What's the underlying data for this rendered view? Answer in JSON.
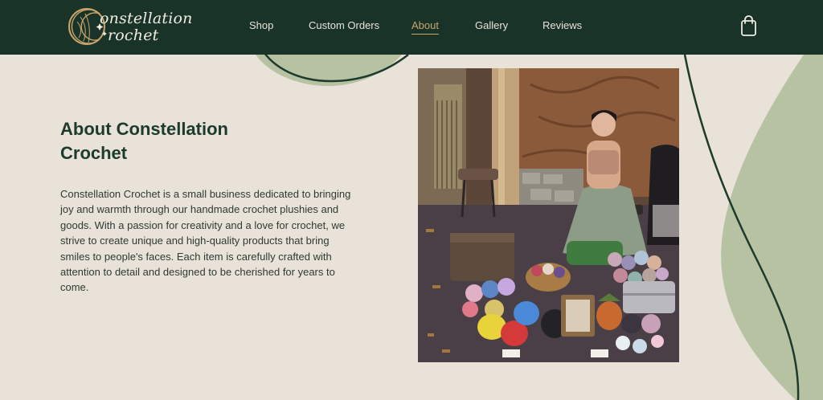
{
  "brand": {
    "line1": "onstellation",
    "line2": "rochet"
  },
  "nav": {
    "items": [
      {
        "label": "Shop"
      },
      {
        "label": "Custom Orders"
      },
      {
        "label": "About",
        "active": true
      },
      {
        "label": "Gallery"
      },
      {
        "label": "Reviews"
      }
    ],
    "cart_icon": "shopping-bag-icon"
  },
  "about": {
    "title": "About Constellation Crochet",
    "body": "Constellation Crochet is a small business dedicated to bringing joy and warmth through our handmade crochet plushies and goods. With a passion for creativity and a love for crochet, we strive to create unique and high-quality products that bring smiles to people's faces. Each item is carefully crafted with attention to detail and designed to be cherished for years to come."
  },
  "colors": {
    "nav_bg": "#1a3329",
    "page_bg": "#e8e2d8",
    "accent": "#c9a56b",
    "heading": "#1d3a2d",
    "sage": "#b7c2a2"
  }
}
